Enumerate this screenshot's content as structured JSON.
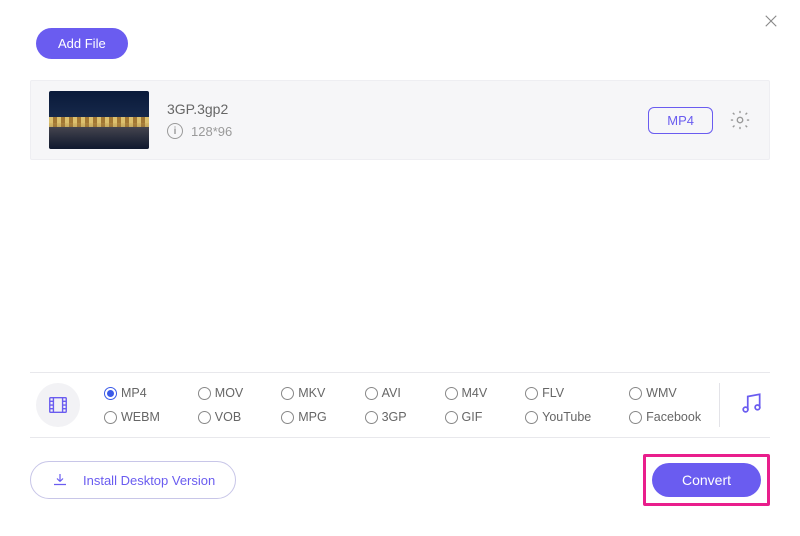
{
  "header": {
    "add_file_label": "Add File"
  },
  "file": {
    "name": "3GP.3gp2",
    "resolution": "128*96",
    "target_format": "MP4"
  },
  "formats": {
    "selected": "MP4",
    "row1": [
      "MP4",
      "MOV",
      "MKV",
      "AVI",
      "M4V",
      "FLV",
      "WMV"
    ],
    "row2": [
      "WEBM",
      "VOB",
      "MPG",
      "3GP",
      "GIF",
      "YouTube",
      "Facebook"
    ]
  },
  "footer": {
    "install_label": "Install Desktop Version",
    "convert_label": "Convert"
  }
}
